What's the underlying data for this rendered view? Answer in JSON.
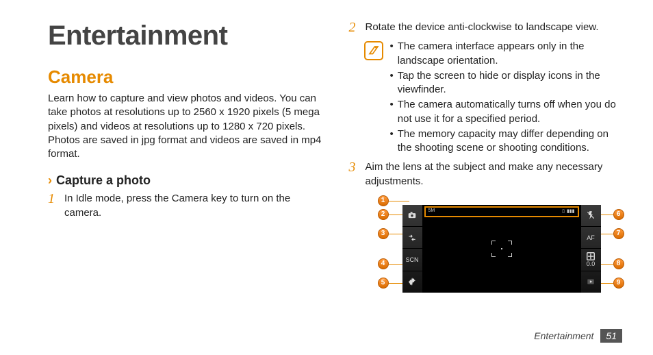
{
  "title": "Entertainment",
  "section": "Camera",
  "intro": "Learn how to capture and view photos and videos. You can take photos at resolutions up to 2560 x 1920 pixels (5 mega pixels) and videos at resolutions up to 1280 x 720 pixels. Photos are saved in jpg format and videos are saved in mp4 format.",
  "subsection": "Capture a photo",
  "steps": {
    "s1": {
      "num": "1",
      "text": "In Idle mode, press the Camera key to turn on the camera."
    },
    "s2": {
      "num": "2",
      "text": "Rotate the device anti-clockwise to landscape view."
    },
    "s3": {
      "num": "3",
      "text": "Aim the lens at the subject and make any necessary adjustments."
    }
  },
  "notes": {
    "n1": "The camera interface appears only in the landscape orientation.",
    "n2": "Tap the screen to hide or display icons in the viewfinder.",
    "n3": "The camera automatically turns off when you do not use it for a specified period.",
    "n4": "The memory capacity may differ depending on the shooting scene or shooting conditions."
  },
  "camera_ui": {
    "left_icons": [
      "camera",
      "arrows",
      "SCN",
      "gear"
    ],
    "right_icons": [
      "flash-off",
      "AF",
      "0.0",
      "play"
    ],
    "topbar": {
      "res": "5M"
    }
  },
  "callouts": [
    "1",
    "2",
    "3",
    "4",
    "5",
    "6",
    "7",
    "8",
    "9"
  ],
  "footer": {
    "section": "Entertainment",
    "page": "51"
  }
}
